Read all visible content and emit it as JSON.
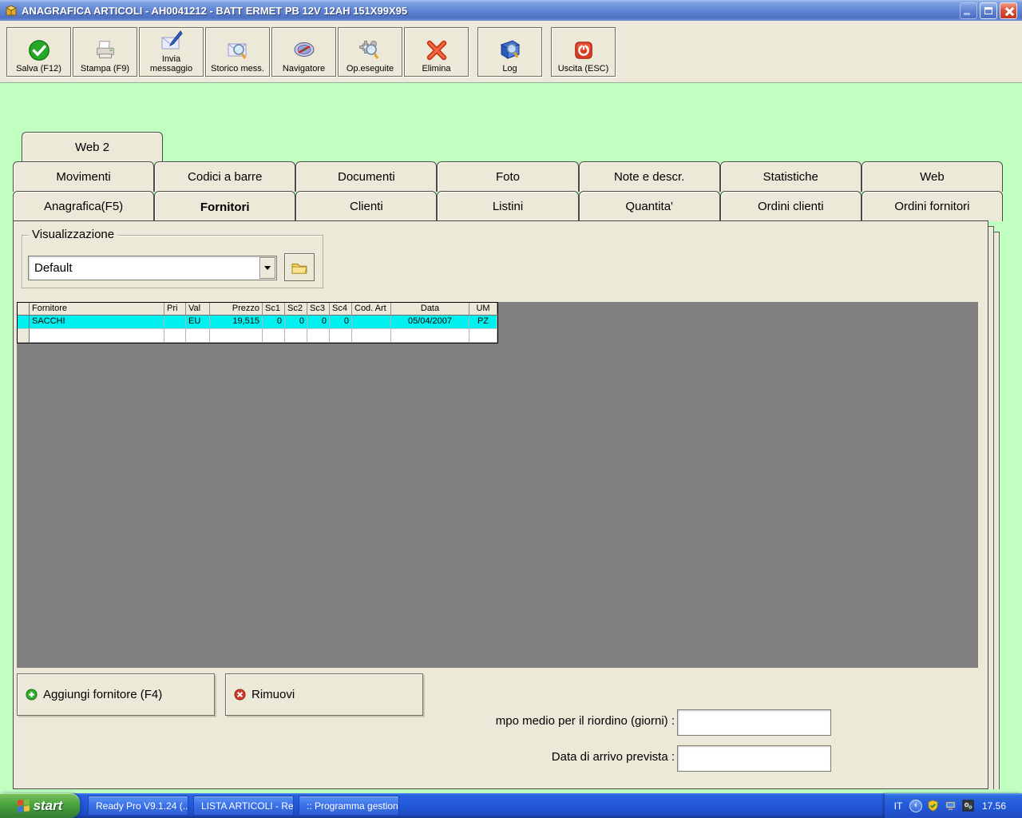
{
  "window": {
    "title": "ANAGRAFICA ARTICOLI - AH0041212 - BATT ERMET PB 12V 12AH 151X99X95"
  },
  "toolbar": {
    "buttons": [
      {
        "label": "Salva (F12)",
        "icon": "save-check-icon"
      },
      {
        "label": "Stampa (F9)",
        "icon": "printer-icon"
      },
      {
        "label": "Invia\nmessaggio",
        "icon": "mail-pen-icon"
      },
      {
        "label": "Storico mess.",
        "icon": "mail-search-icon"
      },
      {
        "label": "Navigatore",
        "icon": "compass-icon"
      },
      {
        "label": "Op.eseguite",
        "icon": "gears-search-icon"
      },
      {
        "label": "Elimina",
        "icon": "red-x-icon"
      },
      {
        "label": "Log",
        "icon": "book-search-icon"
      },
      {
        "label": "Uscita (ESC)",
        "icon": "power-icon"
      }
    ]
  },
  "tabs": {
    "row_top": [
      {
        "label": "Web 2"
      }
    ],
    "row_middle": [
      "Movimenti",
      "Codici a barre",
      "Documenti",
      "Foto",
      "Note e descr.",
      "Statistiche",
      "Web"
    ],
    "row_bottom": [
      "Anagrafica(F5)",
      "Fornitori",
      "Clienti",
      "Listini",
      "Quantita'",
      "Ordini clienti",
      "Ordini fornitori"
    ],
    "selected": "Fornitori"
  },
  "page": {
    "visualizzazione": {
      "label": "Visualizzazione",
      "combo_value": "Default"
    },
    "suppliers_table": {
      "columns": [
        "Fornitore",
        "Pri",
        "Val",
        "Prezzo",
        "Sc1",
        "Sc2",
        "Sc3",
        "Sc4",
        "Cod. Art",
        "Data",
        "UM"
      ],
      "rows": [
        {
          "cells": [
            "SACCHI",
            "",
            "EU",
            "19,515",
            "0",
            "0",
            "0",
            "0",
            "",
            "05/04/2007",
            "PZ"
          ],
          "selected": true
        },
        {
          "cells": [
            "",
            "",
            "",
            "",
            "",
            "",
            "",
            "",
            "",
            "",
            ""
          ],
          "selected": false
        }
      ],
      "selected_row_color": "#00f0f0"
    },
    "buttons": {
      "add": "Aggiungi fornitore (F4)",
      "remove": "Rimuovi"
    },
    "fields": [
      {
        "label": "mpo medio per il riordino (giorni) :",
        "value": ""
      },
      {
        "label": "Data di arrivo prevista :",
        "value": ""
      }
    ]
  },
  "taskbar": {
    "start_label": "start",
    "items": [
      "Ready Pro V9.1.24 (...",
      "LISTA ARTICOLI - Re...",
      ":: Programma gestion..."
    ],
    "tray": {
      "language": "IT",
      "clock": "17.56"
    }
  },
  "colors": {
    "client_background": "#c0ffc0",
    "chrome_beige": "#ece9d8",
    "panel_gray": "#7f7f7f",
    "selection_cyan": "#00f0f0",
    "taskbar_blue": "#2258d8"
  }
}
